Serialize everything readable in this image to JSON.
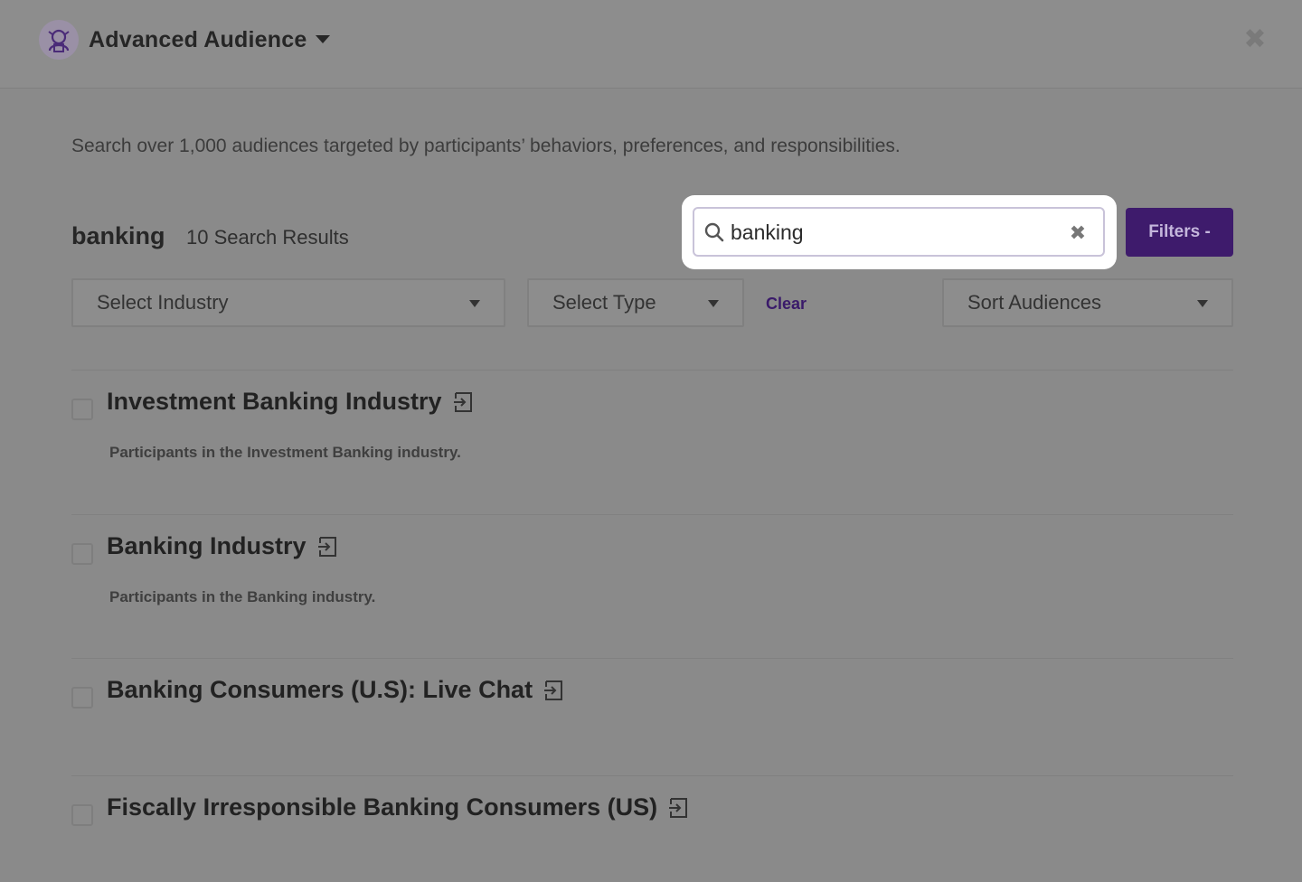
{
  "header": {
    "title": "Advanced Audience",
    "accent_color": "#3e1b6c"
  },
  "description": "Search over 1,000 audiences targeted by participants’ behaviors, preferences, and responsibilities.",
  "results_summary": {
    "query": "banking",
    "count_label": "10 Search Results"
  },
  "search": {
    "value": "banking"
  },
  "filters_button": "Filters -",
  "selects": {
    "industry": "Select Industry",
    "type": "Select Type",
    "sort": "Sort Audiences"
  },
  "clear_label": "Clear",
  "results": [
    {
      "title": "Investment Banking Industry",
      "description": "Participants in the Investment Banking industry."
    },
    {
      "title": "Banking Industry",
      "description": "Participants in the Banking industry."
    },
    {
      "title": "Banking Consumers (U.S): Live Chat",
      "description": ""
    },
    {
      "title": "Fiscally Irresponsible Banking Consumers (US)",
      "description": ""
    }
  ]
}
